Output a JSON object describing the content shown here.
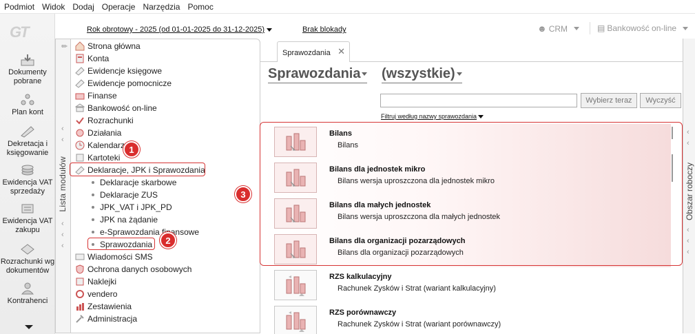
{
  "menu": [
    "Podmiot",
    "Widok",
    "Dodaj",
    "Operacje",
    "Narzędzia",
    "Pomoc"
  ],
  "logo_text": "GT",
  "shortcuts": [
    {
      "label": "Dokumenty pobrane",
      "icon": "download-icon"
    },
    {
      "label": "Plan kont",
      "icon": "chart-of-accounts-icon"
    },
    {
      "label": "Dekretacja i księgowanie",
      "icon": "posting-icon"
    },
    {
      "label": "Ewidencja VAT sprzedaży",
      "icon": "vat-sales-icon"
    },
    {
      "label": "Ewidencja VAT zakupu",
      "icon": "vat-purchase-icon"
    },
    {
      "label": "Rozrachunki wg dokumentów",
      "icon": "settlements-icon"
    },
    {
      "label": "Kontrahenci",
      "icon": "contractors-icon"
    }
  ],
  "toolbar": {
    "year": "Rok obrotowy - 2025  (od 01-01-2025 do 31-12-2025)",
    "lock": "Brak blokady",
    "crm": "CRM",
    "bank": "Bankowość on-line"
  },
  "modules_tab_label": "Lista modułów",
  "workspace_tab_label": "Obszar roboczy",
  "tree": {
    "items": [
      {
        "label": "Strona główna",
        "icon": "home-icon"
      },
      {
        "label": "Konta",
        "icon": "accounts-icon"
      },
      {
        "label": "Ewidencje księgowe",
        "icon": "ledger-icon"
      },
      {
        "label": "Ewidencje pomocnicze",
        "icon": "aux-ledger-icon"
      },
      {
        "label": "Finanse",
        "icon": "finance-icon"
      },
      {
        "label": "Bankowość on-line",
        "icon": "bank-icon"
      },
      {
        "label": "Rozrachunki",
        "icon": "settlements-icon"
      },
      {
        "label": "Działania",
        "icon": "actions-icon"
      },
      {
        "label": "Kalendarz",
        "icon": "calendar-icon"
      },
      {
        "label": "Kartoteki",
        "icon": "records-icon"
      },
      {
        "label": "Deklaracje, JPK i Sprawozdania",
        "icon": "declarations-icon"
      }
    ],
    "subitems": [
      "Deklaracje skarbowe",
      "Deklaracje ZUS",
      "JPK_VAT i JPK_PD",
      "JPK na żądanie",
      "e-Sprawozdania finansowe",
      "Sprawozdania"
    ],
    "items_after": [
      {
        "label": "Wiadomości SMS",
        "icon": "sms-icon"
      },
      {
        "label": "Ochrona danych osobowych",
        "icon": "privacy-icon"
      },
      {
        "label": "Naklejki",
        "icon": "stickers-icon"
      },
      {
        "label": "vendero",
        "icon": "vendero-icon"
      },
      {
        "label": "Zestawienia",
        "icon": "summaries-icon"
      },
      {
        "label": "Administracja",
        "icon": "admin-icon"
      }
    ]
  },
  "badges": [
    "1",
    "2",
    "3"
  ],
  "main": {
    "tab_label": "Sprawozdania",
    "title": "Sprawozdania",
    "filter_value": "(wszystkie)",
    "search_value": "",
    "choose_button": "Wybierz teraz",
    "clear_button": "Wyczyść",
    "filter_label": "Filtruj według nazwy sprawozdania",
    "reports": [
      {
        "name": "Bilans",
        "desc": "Bilans"
      },
      {
        "name": "Bilans dla jednostek mikro",
        "desc": "Bilans wersja uproszczona dla jednostek mikro"
      },
      {
        "name": "Bilans dla małych jednostek",
        "desc": "Bilans wersja uproszczona dla małych jednostek"
      },
      {
        "name": "Bilans dla organizacji pozarządowych",
        "desc": "Bilans dla organizacji pozarządowych"
      },
      {
        "name": "RZS kalkulacyjny",
        "desc": "Rachunek Zysków i Strat (wariant kalkulacyjny)"
      },
      {
        "name": "RZS porównawczy",
        "desc": "Rachunek Zysków i Strat (wariant porównawczy)"
      }
    ]
  },
  "colors": {
    "highlight": "#d63333",
    "badge": "#d92d2d"
  }
}
